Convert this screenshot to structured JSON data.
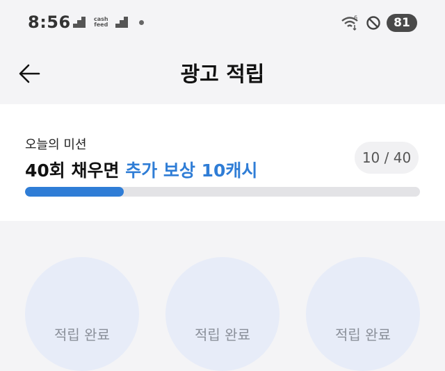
{
  "status_bar": {
    "time": "8:56",
    "notification_logo_text": "cash feed",
    "battery_level": "81"
  },
  "header": {
    "title": "광고 적립"
  },
  "mission": {
    "label": "오늘의 미션",
    "headline_prefix": "40회 채우면",
    "headline_highlight": "추가 보상 10캐시",
    "progress_text": "10 / 40",
    "progress_current": 10,
    "progress_total": 40,
    "accent_color": "#2f7dd6"
  },
  "ads": [
    {
      "label": "적립 완료"
    },
    {
      "label": "적립 완료"
    },
    {
      "label": "적립 완료"
    }
  ]
}
